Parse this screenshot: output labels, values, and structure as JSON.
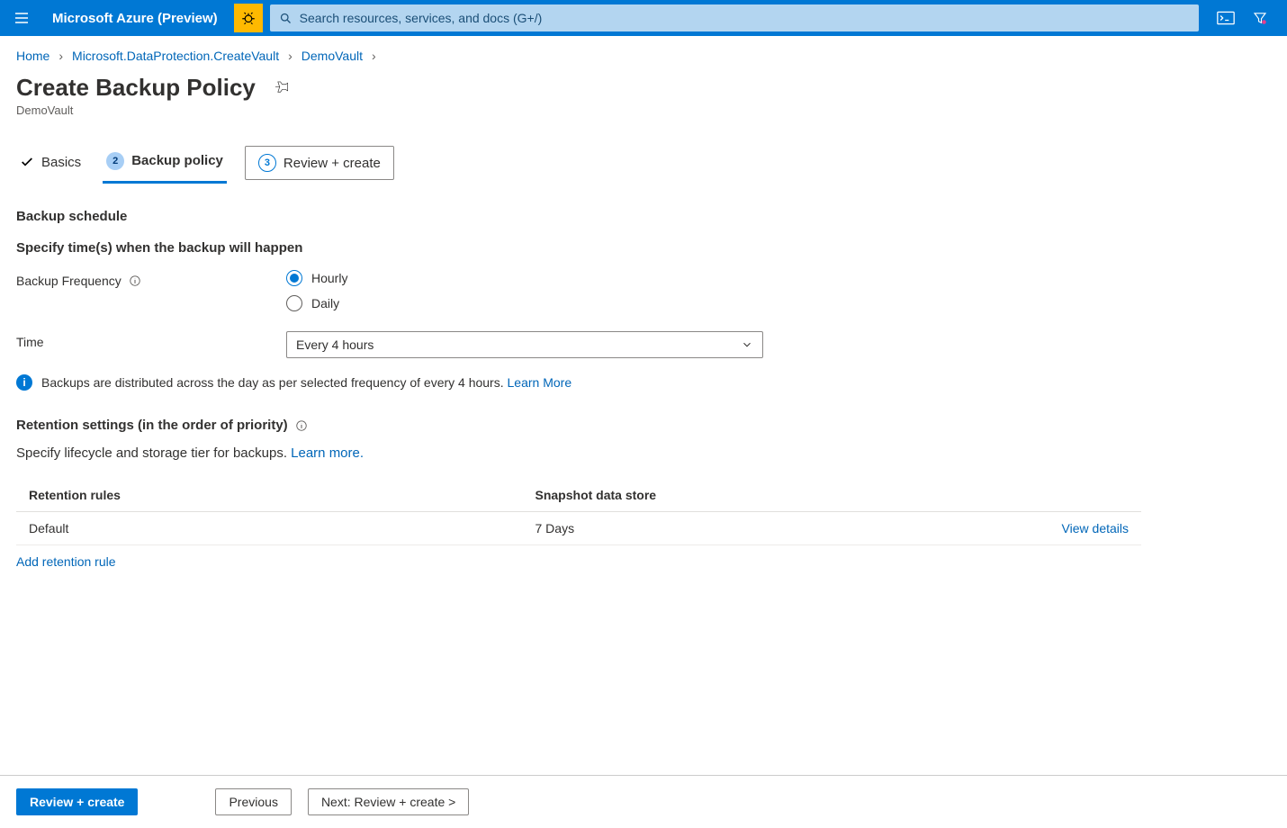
{
  "header": {
    "brand": "Microsoft Azure (Preview)",
    "search_placeholder": "Search resources, services, and docs (G+/)"
  },
  "breadcrumb": {
    "items": [
      "Home",
      "Microsoft.DataProtection.CreateVault",
      "DemoVault"
    ]
  },
  "page": {
    "title": "Create Backup Policy",
    "subtitle": "DemoVault"
  },
  "tabs": {
    "items": [
      {
        "label": "Basics"
      },
      {
        "num": "2",
        "label": "Backup policy"
      },
      {
        "num": "3",
        "label": "Review + create"
      }
    ]
  },
  "schedule": {
    "section_title": "Backup schedule",
    "section_sub": "Specify time(s) when the backup will happen",
    "frequency_label": "Backup Frequency",
    "options": {
      "hourly": "Hourly",
      "daily": "Daily"
    },
    "time_label": "Time",
    "time_value": "Every 4 hours",
    "info_text": "Backups are distributed across the day as per selected frequency of every 4 hours.",
    "info_link": "Learn More"
  },
  "retention": {
    "header": "Retention settings (in the order of priority)",
    "sub_text": "Specify lifecycle and storage tier for backups.",
    "sub_link": "Learn more.",
    "columns": {
      "rules": "Retention rules",
      "store": "Snapshot data store"
    },
    "rows": [
      {
        "name": "Default",
        "store": "7 Days",
        "action": "View details"
      }
    ],
    "add_rule": "Add retention rule"
  },
  "footer": {
    "review": "Review + create",
    "previous": "Previous",
    "next": "Next: Review + create >"
  }
}
